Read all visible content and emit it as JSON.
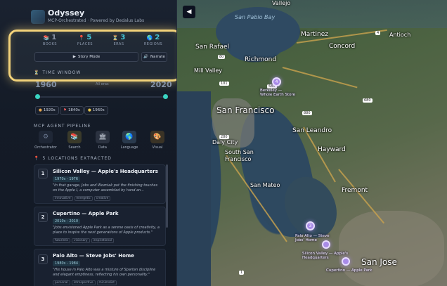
{
  "app": {
    "title": "Odyssey",
    "subtitle": "MCP-Orchestrated · Powered by Dedalus Labs"
  },
  "stats": [
    {
      "value": "1",
      "label": "BOOKS",
      "icon": "book-icon",
      "color": "#8a94a6"
    },
    {
      "value": "5",
      "label": "PLACES",
      "icon": "pin-icon",
      "color": "#45c7d8"
    },
    {
      "value": "3",
      "label": "ERAS",
      "icon": "hourglass-icon",
      "color": "#45c7d8"
    },
    {
      "value": "2",
      "label": "REGIONS",
      "icon": "globe-icon",
      "color": "#45c7d8"
    }
  ],
  "buttons": {
    "story_mode": "Story Mode",
    "narrate": "Narrate"
  },
  "time_window": {
    "title": "TIME WINDOW",
    "start_year": "1960",
    "end_year": "2020",
    "range_label": "All eras",
    "eras": [
      "1920s",
      "1840s",
      "1960s"
    ]
  },
  "pipeline": {
    "title": "MCP AGENT PIPELINE",
    "agents": [
      {
        "name": "Orchestrator",
        "icon": "orchestrator-icon"
      },
      {
        "name": "Search",
        "icon": "search-icon"
      },
      {
        "name": "Data",
        "icon": "data-icon"
      },
      {
        "name": "Language",
        "icon": "language-icon"
      },
      {
        "name": "Visual",
        "icon": "visual-icon"
      }
    ]
  },
  "locations": {
    "title": "5 LOCATIONS EXTRACTED",
    "items": [
      {
        "num": "1",
        "title": "Silicon Valley — Apple's Headquarters",
        "years": "1970s - 1976",
        "quote": "\"In that garage, Jobs and Wozniak put the finishing touches on the Apple I, a computer assembled by hand an...",
        "tags": [
          "innovative",
          "energetic",
          "creative"
        ]
      },
      {
        "num": "2",
        "title": "Cupertino — Apple Park",
        "years": "2010s - 2010",
        "quote": "\"Jobs envisioned Apple Park as a serene oasis of creativity, a place to inspire the next generations of Apple products.\"",
        "tags": [
          "futuristic",
          "visionary",
          "inspirational"
        ]
      },
      {
        "num": "3",
        "title": "Palo Alto — Steve Jobs' Home",
        "years": "1980s - 1984",
        "quote": "\"His house in Palo Alto was a mixture of Spartan discipline and elegant emptiness, reflecting his own personality.\"",
        "tags": [
          "personal",
          "introspective",
          "minimalist"
        ]
      }
    ]
  },
  "map": {
    "labels": {
      "san_pablo_bay": "San Pablo Bay",
      "vallejo": "Vallejo",
      "martinez": "Martinez",
      "antioch": "Antioch",
      "san_rafael": "San Rafael",
      "richmond": "Richmond",
      "concord": "Concord",
      "mill_valley": "Mill Valley",
      "san_francisco": "San Francisco",
      "san_leandro": "San Leandro",
      "daly_city": "Daly City",
      "south_sf_1": "South San",
      "south_sf_2": "Francisco",
      "hayward": "Hayward",
      "san_mateo": "San Mateo",
      "fremont": "Fremont",
      "san_jose": "San Jose"
    },
    "markers": [
      {
        "num": "4",
        "label_1": "Berkeley —",
        "label_2": "Whole Earth Store"
      },
      {
        "num": "3",
        "label_1": "Palo Alto — Steve",
        "label_2": "Jobs' Home"
      },
      {
        "num": "",
        "label_1": "Silicon Valley — Apple's",
        "label_2": "Headquarters"
      },
      {
        "num": "",
        "label_1": "Cupertino — Apple Park",
        "label_2": ""
      }
    ],
    "highway_badges": [
      "4",
      "80",
      "580",
      "101",
      "880",
      "280",
      "680",
      "1"
    ]
  },
  "colors": {
    "accent": "#45c7d8",
    "highlight": "#f2d27a",
    "marker": "#a98be8"
  }
}
